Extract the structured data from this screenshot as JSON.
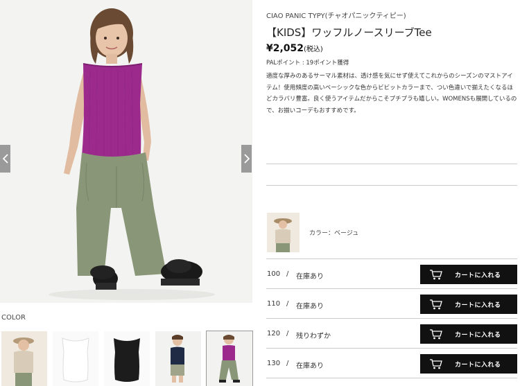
{
  "gallery": {
    "color_heading": "COLOR",
    "prev_icon": "chevron-left-icon",
    "next_icon": "chevron-right-icon",
    "thumbnails": [
      {
        "color": "beige"
      },
      {
        "color": "white"
      },
      {
        "color": "black"
      },
      {
        "color": "navy"
      },
      {
        "color": "purple"
      }
    ],
    "selected_thumbnail": 4
  },
  "product": {
    "brand": "CIAO PANIC TYPY(チャオパニックティピー)",
    "title": "【KIDS】ワッフルノースリーブTee",
    "price": "¥2,052",
    "tax": "(税込)",
    "points": "PALポイント : 19ポイント獲得",
    "description": "適度な厚みのあるサーマル素材は、透け感を気にせず使えてこれからのシーズンのマストアイテム！使用頻度の高いベーシックな色からビビットカラーまで、つい色違いで揃えたくなるほどカラバリ豊富。良く使うアイテムだからこそプチプラも嬉しい。WOMENSも展開しているので、お揃いコーデもおすすめです。"
  },
  "variant": {
    "color_label": "カラー：ベージュ"
  },
  "sizes": [
    {
      "size": "100",
      "separator": "/",
      "stock": "在庫あり",
      "button": "カートに入れる"
    },
    {
      "size": "110",
      "separator": "/",
      "stock": "在庫あり",
      "button": "カートに入れる"
    },
    {
      "size": "120",
      "separator": "/",
      "stock": "残りわずか",
      "button": "カートに入れる"
    },
    {
      "size": "130",
      "separator": "/",
      "stock": "在庫あり",
      "button": "カートに入れる"
    }
  ],
  "colors": {
    "button_bg": "#111111",
    "top_purple": "#9b2a8c",
    "pants_khaki": "#8a9678"
  }
}
